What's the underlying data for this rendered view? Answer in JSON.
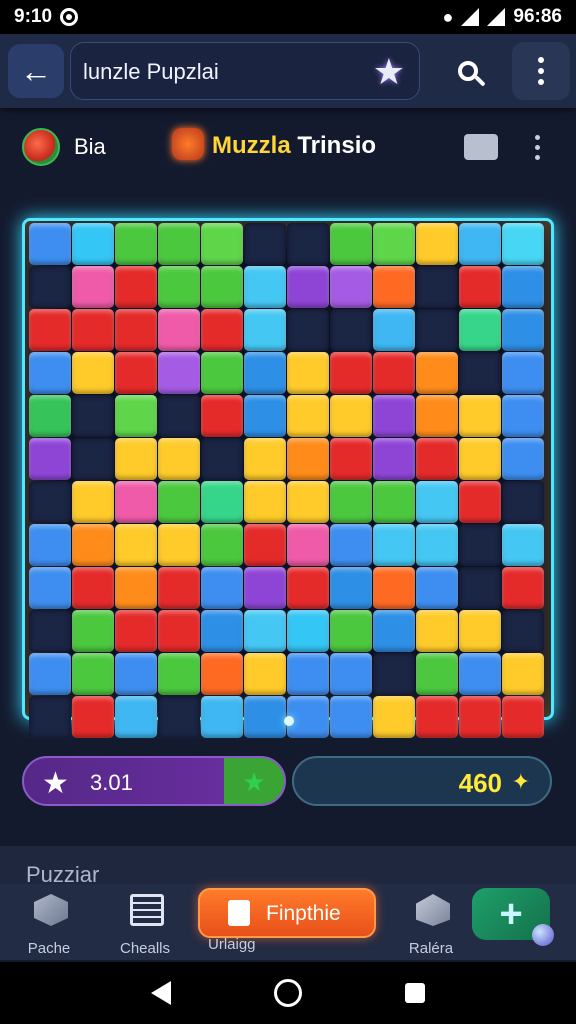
{
  "status_bar": {
    "time": "9:10",
    "clock_right": "96:86"
  },
  "top_bar": {
    "title": "lunzle Pupzlai"
  },
  "sub_header": {
    "player_name": "Bia",
    "game_title_part1": "Muzzla",
    "game_title_part2": " Trinsio"
  },
  "board": {
    "columns": 12,
    "rows": 12,
    "tile_colors": [
      [
        "#3d8ef0",
        "#34c6f5",
        "#4cc83f",
        "#4cc83f",
        "#5fd64a",
        "#1b2544",
        "#1b2544",
        "#4cc83f",
        "#5fd64a",
        "#ffcb2a",
        "#3fb7f2",
        "#47d7f5"
      ],
      [
        "#1b2544",
        "#ef5ba8",
        "#e52a2a",
        "#4cc83f",
        "#4cc83f",
        "#45c7f3",
        "#8e45d6",
        "#a55be4",
        "#ff6a23",
        "#1b2544",
        "#e52a2a",
        "#2e8fe6"
      ],
      [
        "#e52a2a",
        "#e52a2a",
        "#e52a2a",
        "#ef5ba8",
        "#e52a2a",
        "#45c7f3",
        "#1b2544",
        "#1b2544",
        "#3fb7f2",
        "#1b2544",
        "#36d68a",
        "#2e8fe6"
      ],
      [
        "#3d8ef0",
        "#ffcb2a",
        "#e52a2a",
        "#a55be4",
        "#4cc83f",
        "#2e8fe6",
        "#ffcb2a",
        "#e52a2a",
        "#e52a2a",
        "#ff8c1a",
        "#1b2544",
        "#3d8ef0"
      ],
      [
        "#36c45a",
        "#1b2544",
        "#5fd64a",
        "#1b2544",
        "#e52a2a",
        "#2e8fe6",
        "#ffcb2a",
        "#ffcb2a",
        "#8e45d6",
        "#ff8c1a",
        "#ffcb2a",
        "#3d8ef0"
      ],
      [
        "#8e45d6",
        "#1b2544",
        "#ffcb2a",
        "#ffcb2a",
        "#1b2544",
        "#ffcb2a",
        "#ff8c1a",
        "#e52a2a",
        "#8e45d6",
        "#e52a2a",
        "#ffcb2a",
        "#3d8ef0"
      ],
      [
        "#1b2544",
        "#ffcb2a",
        "#ef5ba8",
        "#4cc83f",
        "#36d68a",
        "#ffcb2a",
        "#ffcb2a",
        "#4cc83f",
        "#4cc83f",
        "#45c7f3",
        "#e52a2a",
        "#1b2544"
      ],
      [
        "#3d8ef0",
        "#ff8c1a",
        "#ffcb2a",
        "#ffcb2a",
        "#4cc83f",
        "#e52a2a",
        "#ef5ba8",
        "#3d8ef0",
        "#45c7f3",
        "#45c7f3",
        "#1b2544",
        "#45c7f3"
      ],
      [
        "#3d8ef0",
        "#e52a2a",
        "#ff8c1a",
        "#e52a2a",
        "#3d8ef0",
        "#8e45d6",
        "#e52a2a",
        "#2e8fe6",
        "#ff6a23",
        "#3d8ef0",
        "#1b2544",
        "#e52a2a"
      ],
      [
        "#1b2544",
        "#4cc83f",
        "#e52a2a",
        "#e52a2a",
        "#2e8fe6",
        "#45c7f3",
        "#34c6f5",
        "#4cc83f",
        "#2e8fe6",
        "#ffcb2a",
        "#ffcb2a",
        "#1b2544"
      ],
      [
        "#3d8ef0",
        "#4cc83f",
        "#3d8ef0",
        "#4cc83f",
        "#ff6a23",
        "#ffcb2a",
        "#3d8ef0",
        "#3d8ef0",
        "#1b2544",
        "#4cc83f",
        "#3d8ef0",
        "#ffcb2a"
      ],
      [
        "#1b2544",
        "#e52a2a",
        "#3fb7f2",
        "#1b2544",
        "#3fb7f2",
        "#2e8fe6",
        "#3d8ef0",
        "#3d8ef0",
        "#ffcb2a",
        "#e52a2a",
        "#e52a2a",
        "#e52a2a"
      ]
    ]
  },
  "score_bar": {
    "score": "3.01",
    "coins": "460"
  },
  "bottom_panel": {
    "label": "Puzziar"
  },
  "bottom_nav": {
    "items": [
      {
        "label": "Pache",
        "icon": "box-icon"
      },
      {
        "label": "Chealls",
        "icon": "list-icon"
      },
      {
        "label": "Raléra",
        "icon": "stack-icon"
      }
    ],
    "cta_label": "Finpthie",
    "cta_sublabel": "Urlaigg"
  }
}
